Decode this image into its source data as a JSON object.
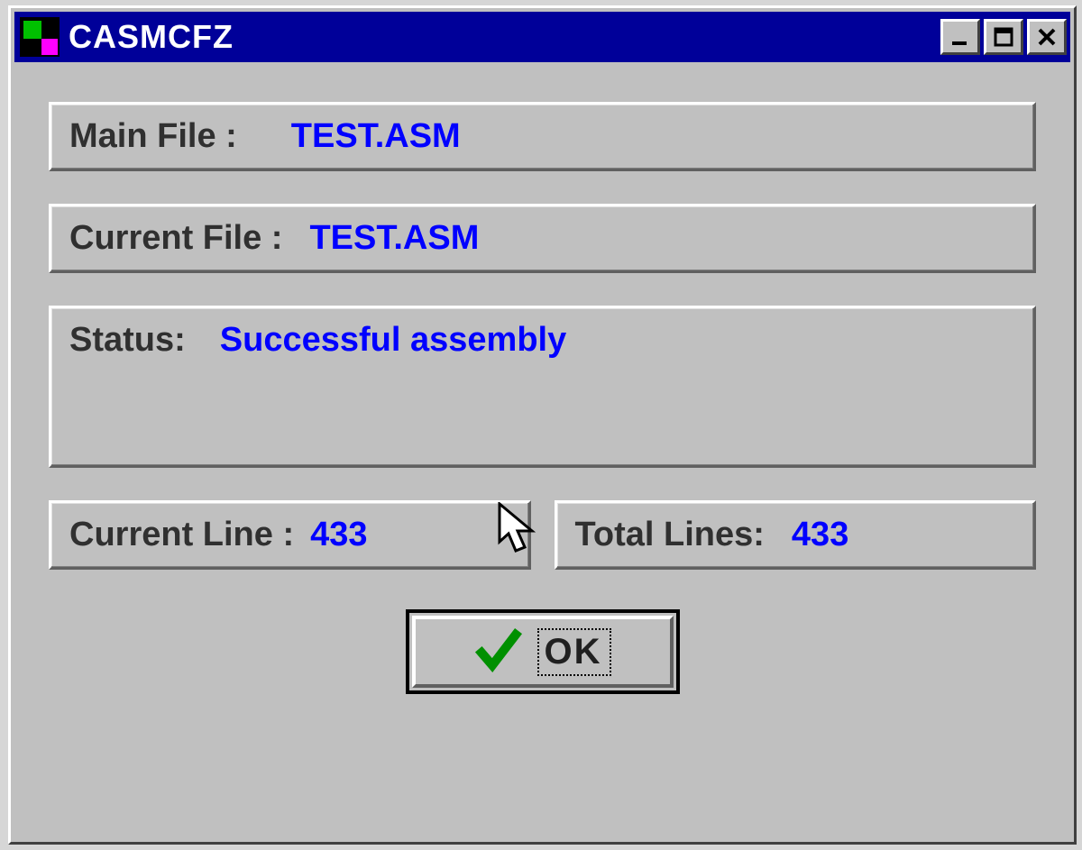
{
  "window": {
    "title": "CASMCFZ"
  },
  "fields": {
    "mainFile": {
      "label": "Main File :",
      "value": "TEST.ASM"
    },
    "currentFile": {
      "label": "Current File :",
      "value": "TEST.ASM"
    },
    "status": {
      "label": "Status:",
      "value": "Successful assembly"
    },
    "currentLine": {
      "label": "Current Line :",
      "value": "433"
    },
    "totalLines": {
      "label": "Total Lines:",
      "value": "433"
    }
  },
  "buttons": {
    "ok": "OK"
  },
  "icons": {
    "minimize": "minimize-icon",
    "maximize": "maximize-icon",
    "close": "close-icon",
    "check": "check-icon",
    "app": "app-icon"
  },
  "colors": {
    "titlebar": "#000099",
    "face": "#c0c0c0",
    "blue": "#0000ff"
  }
}
